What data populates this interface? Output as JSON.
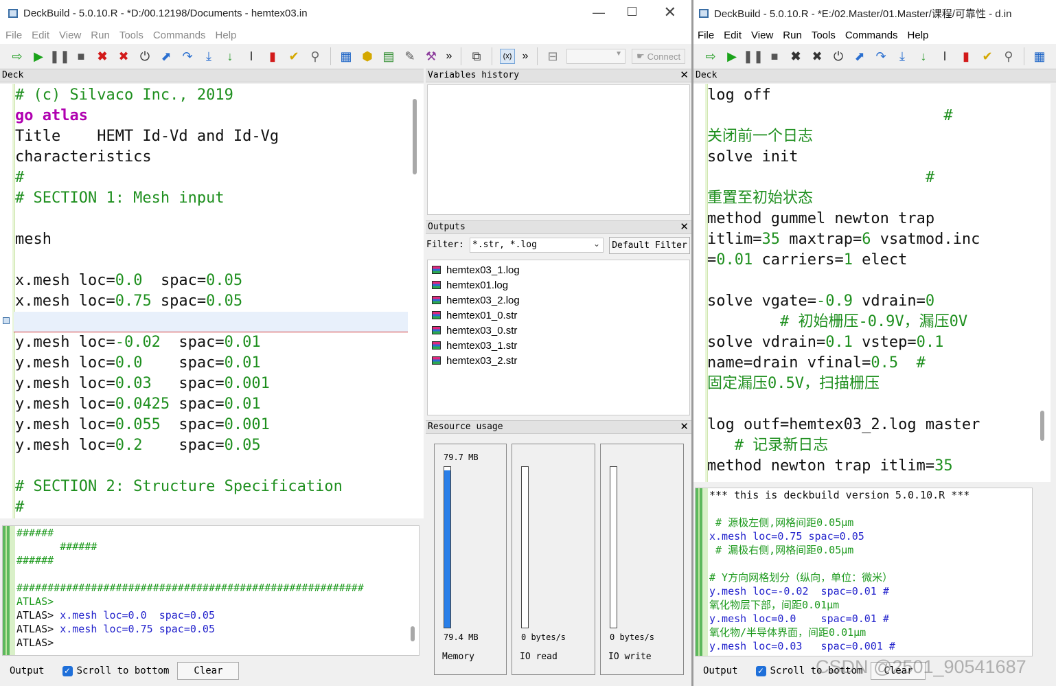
{
  "left_window": {
    "title": "DeckBuild - 5.0.10.R - *D:/00.12198/Documents - hemtex03.in",
    "menu": [
      "File",
      "Edit",
      "View",
      "Run",
      "Tools",
      "Commands",
      "Help"
    ],
    "toolbar": {
      "connect_label": "Connect",
      "more": "»"
    },
    "deck": {
      "header": "Deck",
      "lines": [
        [
          {
            "t": "# (c) Silvaco Inc., 2019",
            "c": "comment"
          }
        ],
        [
          {
            "t": "go atlas",
            "c": "kw"
          }
        ],
        [
          {
            "t": "Title    HEMT Id-Vd and Id-Vg",
            "c": "black"
          }
        ],
        [
          {
            "t": "characteristics",
            "c": "black"
          }
        ],
        [
          {
            "t": "#",
            "c": "comment"
          }
        ],
        [
          {
            "t": "# SECTION 1: Mesh input",
            "c": "comment"
          }
        ],
        [],
        [
          {
            "t": "mesh",
            "c": "black"
          }
        ],
        [],
        [
          {
            "t": "x.mesh loc=",
            "c": "black"
          },
          {
            "t": "0.0",
            "c": "num"
          },
          {
            "t": "  spac=",
            "c": "black"
          },
          {
            "t": "0.05",
            "c": "num"
          }
        ],
        [
          {
            "t": "x.mesh loc=",
            "c": "black"
          },
          {
            "t": "0.75",
            "c": "num"
          },
          {
            "t": " spac=",
            "c": "black"
          },
          {
            "t": "0.05",
            "c": "num"
          }
        ],
        [],
        [
          {
            "t": "y.mesh loc=",
            "c": "black"
          },
          {
            "t": "-0.02",
            "c": "num"
          },
          {
            "t": "  spac=",
            "c": "black"
          },
          {
            "t": "0.01",
            "c": "num"
          }
        ],
        [
          {
            "t": "y.mesh loc=",
            "c": "black"
          },
          {
            "t": "0.0",
            "c": "num"
          },
          {
            "t": "    spac=",
            "c": "black"
          },
          {
            "t": "0.01",
            "c": "num"
          }
        ],
        [
          {
            "t": "y.mesh loc=",
            "c": "black"
          },
          {
            "t": "0.03",
            "c": "num"
          },
          {
            "t": "   spac=",
            "c": "black"
          },
          {
            "t": "0.001",
            "c": "num"
          }
        ],
        [
          {
            "t": "y.mesh loc=",
            "c": "black"
          },
          {
            "t": "0.0425",
            "c": "num"
          },
          {
            "t": " spac=",
            "c": "black"
          },
          {
            "t": "0.01",
            "c": "num"
          }
        ],
        [
          {
            "t": "y.mesh loc=",
            "c": "black"
          },
          {
            "t": "0.055",
            "c": "num"
          },
          {
            "t": "  spac=",
            "c": "black"
          },
          {
            "t": "0.001",
            "c": "num"
          }
        ],
        [
          {
            "t": "y.mesh loc=",
            "c": "black"
          },
          {
            "t": "0.2",
            "c": "num"
          },
          {
            "t": "    spac=",
            "c": "black"
          },
          {
            "t": "0.05",
            "c": "num"
          }
        ],
        [],
        [
          {
            "t": "# SECTION 2: Structure Specification",
            "c": "comment"
          }
        ],
        [
          {
            "t": "#",
            "c": "comment"
          }
        ]
      ]
    },
    "console": {
      "lines": [
        [
          {
            "t": "######",
            "c": "green"
          }
        ],
        [
          {
            "t": "       ######",
            "c": "green"
          }
        ],
        [
          {
            "t": "######",
            "c": "green"
          }
        ],
        [],
        [
          {
            "t": "########################################################",
            "c": "green"
          }
        ],
        [
          {
            "t": "ATLAS>",
            "c": "green"
          }
        ],
        [
          {
            "t": "ATLAS> ",
            "c": "black"
          },
          {
            "t": "x.mesh loc=0.0  spac=0.05",
            "c": "blue"
          }
        ],
        [
          {
            "t": "ATLAS> ",
            "c": "black"
          },
          {
            "t": "x.mesh loc=0.75 spac=0.05",
            "c": "blue"
          }
        ],
        [
          {
            "t": "ATLAS>",
            "c": "black"
          }
        ]
      ]
    },
    "bottom": {
      "output_label": "Output",
      "scroll_label": "Scroll to bottom",
      "clear_label": "Clear"
    },
    "variables_history": {
      "header": "Variables history"
    },
    "outputs": {
      "header": "Outputs",
      "filter_label": "Filter:",
      "filter_value": "*.str, *.log",
      "default_filter_label": "Default Filter",
      "files": [
        "hemtex03_1.log",
        "hemtex01.log",
        "hemtex03_2.log",
        "hemtex01_0.str",
        "hemtex03_0.str",
        "hemtex03_1.str",
        "hemtex03_2.str"
      ]
    },
    "resource_usage": {
      "header": "Resource usage",
      "memory": {
        "top": "79.7 MB",
        "bottom": "79.4 MB",
        "label": "Memory",
        "fill_fraction": 0.98
      },
      "io_read": {
        "bottom": "0 bytes/s",
        "label": "IO read",
        "fill_fraction": 0
      },
      "io_write": {
        "bottom": "0 bytes/s",
        "label": "IO write",
        "fill_fraction": 0
      }
    }
  },
  "right_window": {
    "title": "DeckBuild - 5.0.10.R - *E:/02.Master/01.Master/课程/可靠性 - d.in",
    "menu": [
      "File",
      "Edit",
      "View",
      "Run",
      "Tools",
      "Commands",
      "Help"
    ],
    "deck": {
      "header": "Deck",
      "lines": [
        [
          {
            "t": "log off",
            "c": "black"
          }
        ],
        [
          {
            "t": "                          #",
            "c": "comment"
          }
        ],
        [
          {
            "t": "关闭前一个日志",
            "c": "comment"
          }
        ],
        [
          {
            "t": "solve init",
            "c": "black"
          }
        ],
        [
          {
            "t": "                        #",
            "c": "comment"
          }
        ],
        [
          {
            "t": "重置至初始状态",
            "c": "comment"
          }
        ],
        [
          {
            "t": "method gummel newton trap",
            "c": "black"
          }
        ],
        [
          {
            "t": "itlim=",
            "c": "black"
          },
          {
            "t": "35",
            "c": "num"
          },
          {
            "t": " maxtrap=",
            "c": "black"
          },
          {
            "t": "6",
            "c": "num"
          },
          {
            "t": " vsatmod.inc",
            "c": "black"
          }
        ],
        [
          {
            "t": "=",
            "c": "black"
          },
          {
            "t": "0.01",
            "c": "num"
          },
          {
            "t": " carriers=",
            "c": "black"
          },
          {
            "t": "1",
            "c": "num"
          },
          {
            "t": " elect",
            "c": "black"
          }
        ],
        [],
        [
          {
            "t": "solve vgate=",
            "c": "black"
          },
          {
            "t": "-0.9",
            "c": "num"
          },
          {
            "t": " vdrain=",
            "c": "black"
          },
          {
            "t": "0",
            "c": "num"
          }
        ],
        [
          {
            "t": "        # 初始栅压-0.9V，漏压0V",
            "c": "comment"
          }
        ],
        [
          {
            "t": "solve vdrain=",
            "c": "black"
          },
          {
            "t": "0.1",
            "c": "num"
          },
          {
            "t": " vstep=",
            "c": "black"
          },
          {
            "t": "0.1",
            "c": "num"
          }
        ],
        [
          {
            "t": "name=drain vfinal=",
            "c": "black"
          },
          {
            "t": "0.5",
            "c": "num"
          },
          {
            "t": "  #",
            "c": "comment"
          }
        ],
        [
          {
            "t": "固定漏压0.5V，扫描栅压",
            "c": "comment"
          }
        ],
        [],
        [
          {
            "t": "log outf=hemtex03_2.log master",
            "c": "black"
          }
        ],
        [
          {
            "t": "   # 记录新日志",
            "c": "comment"
          }
        ],
        [
          {
            "t": "method newton trap itlim=",
            "c": "black"
          },
          {
            "t": "35",
            "c": "num"
          }
        ]
      ]
    },
    "console": {
      "lines": [
        [
          {
            "t": "*** this is deckbuild version 5.0.10.R ***",
            "c": "black"
          }
        ],
        [],
        [
          {
            "t": " # 源极左侧,网格间距0.05μm",
            "c": "green"
          }
        ],
        [
          {
            "t": "x.mesh loc=0.75 spac=0.05",
            "c": "blue"
          }
        ],
        [
          {
            "t": " # 漏极右侧,网格间距0.05μm",
            "c": "green"
          }
        ],
        [],
        [
          {
            "t": "# Y方向网格划分（纵向，单位：微米）",
            "c": "green"
          }
        ],
        [
          {
            "t": "y.mesh loc=-0.02  spac=0.01 #",
            "c": "blue"
          }
        ],
        [
          {
            "t": "氧化物层下部，间距0.01μm",
            "c": "green"
          }
        ],
        [
          {
            "t": "y.mesh loc=0.0    spac=0.01 #",
            "c": "blue"
          }
        ],
        [
          {
            "t": "氧化物/半导体界面，间距0.01μm",
            "c": "green"
          }
        ],
        [
          {
            "t": "y.mesh loc=0.03   spac=0.001 #",
            "c": "blue"
          }
        ]
      ]
    },
    "bottom": {
      "output_label": "Output",
      "scroll_label": "Scroll to bottom",
      "clear_label": "Clear"
    }
  },
  "watermark": "CSDN @2501_90541687",
  "colors": {
    "comment": "#1e8f1e",
    "keyword": "#b000b0",
    "console_blue": "#2222cc",
    "memory_bar": "#2a7fe8"
  }
}
